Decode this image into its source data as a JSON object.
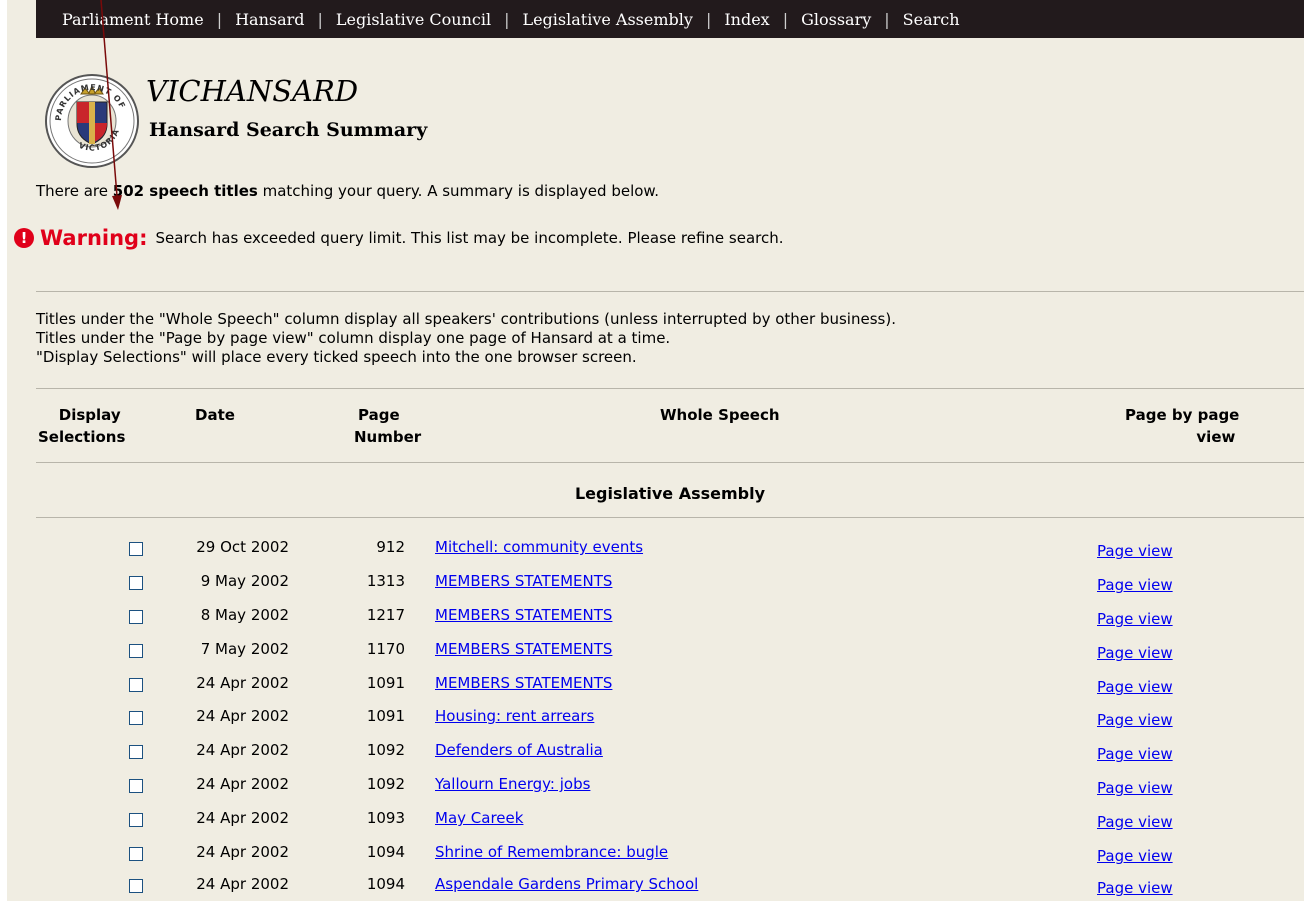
{
  "nav": {
    "items": [
      "Parliament Home",
      "Hansard",
      "Legislative Council",
      "Legislative Assembly",
      "Index",
      "Glossary",
      "Search"
    ]
  },
  "header": {
    "site_title": "VICHANSARD",
    "page_title": "Hansard Search Summary",
    "logo_text_top": "PARLIAMENT OF",
    "logo_text_bottom": "VICTORIA"
  },
  "summary": {
    "prefix": "There are ",
    "count": "502 speech titles",
    "suffix": " matching your query. A summary is displayed below."
  },
  "warning": {
    "icon": "!",
    "label": "Warning:",
    "text": "Search has exceeded query limit. This list may be incomplete. Please refine search."
  },
  "help": [
    "Titles under the \"Whole Speech\" column display all speakers' contributions (unless interrupted by other business).",
    "Titles under the \"Page by page view\" column display one page of Hansard at a time.",
    "\"Display Selections\" will place every ticked speech into the one browser screen."
  ],
  "table": {
    "headers": {
      "select_l1": "Display",
      "select_l2": "Selections",
      "date": "Date",
      "page_l1": "Page",
      "page_l2": "Number",
      "speech": "Whole Speech",
      "view_l1": "Page by page",
      "view_l2": "view"
    },
    "section": "Legislative Assembly",
    "rows": [
      {
        "date": "29 Oct 2002",
        "page": "912",
        "title": "Mitchell: community events",
        "view": "Page view"
      },
      {
        "date": "9 May 2002",
        "page": "1313",
        "title": "MEMBERS STATEMENTS",
        "view": "Page view"
      },
      {
        "date": "8 May 2002",
        "page": "1217",
        "title": "MEMBERS STATEMENTS",
        "view": "Page view"
      },
      {
        "date": "7 May 2002",
        "page": "1170",
        "title": "MEMBERS STATEMENTS",
        "view": "Page view"
      },
      {
        "date": "24 Apr 2002",
        "page": "1091",
        "title": "MEMBERS STATEMENTS",
        "view": "Page view"
      },
      {
        "date": "24 Apr 2002",
        "page": "1091",
        "title": "Housing: rent arrears",
        "view": "Page view"
      },
      {
        "date": "24 Apr 2002",
        "page": "1092",
        "title": "Defenders of Australia",
        "view": "Page view"
      },
      {
        "date": "24 Apr 2002",
        "page": "1092",
        "title": "Yallourn Energy: jobs",
        "view": "Page view"
      },
      {
        "date": "24 Apr 2002",
        "page": "1093",
        "title": "May Careek",
        "view": "Page view"
      },
      {
        "date": "24 Apr 2002",
        "page": "1094",
        "title": "Shrine of Remembrance: bugle",
        "view": "Page view"
      },
      {
        "date": "24 Apr 2002",
        "page": "1094",
        "title": "Aspendale Gardens Primary School",
        "view": "Page view"
      }
    ]
  },
  "colors": {
    "nav_bg": "#221a1c",
    "page_bg": "#f0ede2",
    "warning": "#e0001a",
    "link": "#0000ee",
    "arrow": "#7a0a0a"
  }
}
